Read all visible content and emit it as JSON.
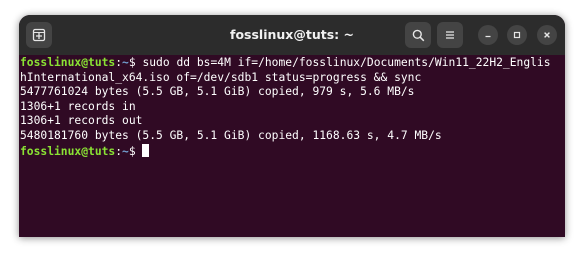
{
  "window": {
    "title": "fosslinux@tuts: ~",
    "colors": {
      "titlebar": "#2c2c2c",
      "terminal_bg": "#300a24",
      "prompt_user": "#8ae234",
      "prompt_path": "#729fcf",
      "text": "#ffffff"
    }
  },
  "titlebar": {
    "new_tab_icon": "new-tab-icon",
    "search_icon": "search-icon",
    "menu_icon": "hamburger-menu-icon",
    "minimize_icon": "minimize-icon",
    "maximize_icon": "maximize-icon",
    "close_icon": "close-icon"
  },
  "terminal": {
    "prompt1": {
      "user": "fosslinux@tuts",
      "sep": ":",
      "path": "~",
      "symbol": "$ ",
      "command_part1": "sudo dd bs=4M if=/home/fosslinux/Documents/Win11_22H2_Englis",
      "command_part2": "hInternational_x64.iso of=/dev/sdb1 status=progress && sync"
    },
    "output": [
      "5477761024 bytes (5.5 GB, 5.1 GiB) copied, 979 s, 5.6 MB/s",
      "1306+1 records in",
      "1306+1 records out",
      "5480181760 bytes (5.5 GB, 5.1 GiB) copied, 1168.63 s, 4.7 MB/s"
    ],
    "prompt2": {
      "user": "fosslinux@tuts",
      "sep": ":",
      "path": "~",
      "symbol": "$ "
    }
  }
}
